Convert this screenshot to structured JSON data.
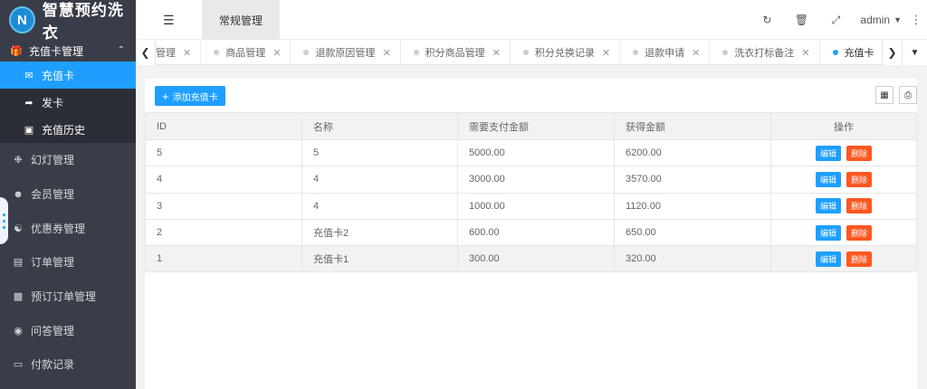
{
  "app": {
    "logo_letter": "N",
    "title": "智慧预约洗衣"
  },
  "sidebar": {
    "group": {
      "label": "充值卡管理",
      "icon": "gift-icon"
    },
    "sub_items": [
      {
        "label": "充值卡",
        "icon": "envelope-icon",
        "active": true
      },
      {
        "label": "发卡",
        "icon": "send-card-icon",
        "active": false
      },
      {
        "label": "充值历史",
        "icon": "briefcase-icon",
        "active": false
      }
    ],
    "items": [
      {
        "label": "幻灯管理",
        "icon": "slides-icon"
      },
      {
        "label": "会员管理",
        "icon": "member-icon"
      },
      {
        "label": "优惠券管理",
        "icon": "coupon-icon"
      },
      {
        "label": "订单管理",
        "icon": "order-icon"
      },
      {
        "label": "预订订单管理",
        "icon": "booking-icon"
      },
      {
        "label": "问答管理",
        "icon": "qa-icon"
      },
      {
        "label": "付款记录",
        "icon": "payment-icon"
      }
    ]
  },
  "header": {
    "tab_label": "常规管理",
    "user": "admin",
    "icons": [
      "refresh-icon",
      "trash-icon",
      "fullscreen-icon"
    ]
  },
  "tabs": [
    {
      "label": "管理",
      "active": false,
      "dot": false
    },
    {
      "label": "商品管理",
      "active": false,
      "dot": true
    },
    {
      "label": "退款原因管理",
      "active": false,
      "dot": true
    },
    {
      "label": "积分商品管理",
      "active": false,
      "dot": true
    },
    {
      "label": "积分兑换记录",
      "active": false,
      "dot": true
    },
    {
      "label": "退款申请",
      "active": false,
      "dot": true
    },
    {
      "label": "洗衣打标备注",
      "active": false,
      "dot": true
    },
    {
      "label": "充值卡",
      "active": true,
      "dot": true
    }
  ],
  "toolbar": {
    "add_label": "添加充值卡"
  },
  "table": {
    "columns": [
      "ID",
      "名称",
      "需要支付金额",
      "获得金额",
      "操作"
    ],
    "edit_label": "编辑",
    "delete_label": "删除",
    "rows": [
      [
        "5",
        "5",
        "5000.00",
        "6200.00"
      ],
      [
        "4",
        "4",
        "3000.00",
        "3570.00"
      ],
      [
        "3",
        "4",
        "1000.00",
        "1120.00"
      ],
      [
        "2",
        "充值卡2",
        "600.00",
        "650.00"
      ],
      [
        "1",
        "充值卡1",
        "300.00",
        "320.00"
      ]
    ]
  }
}
